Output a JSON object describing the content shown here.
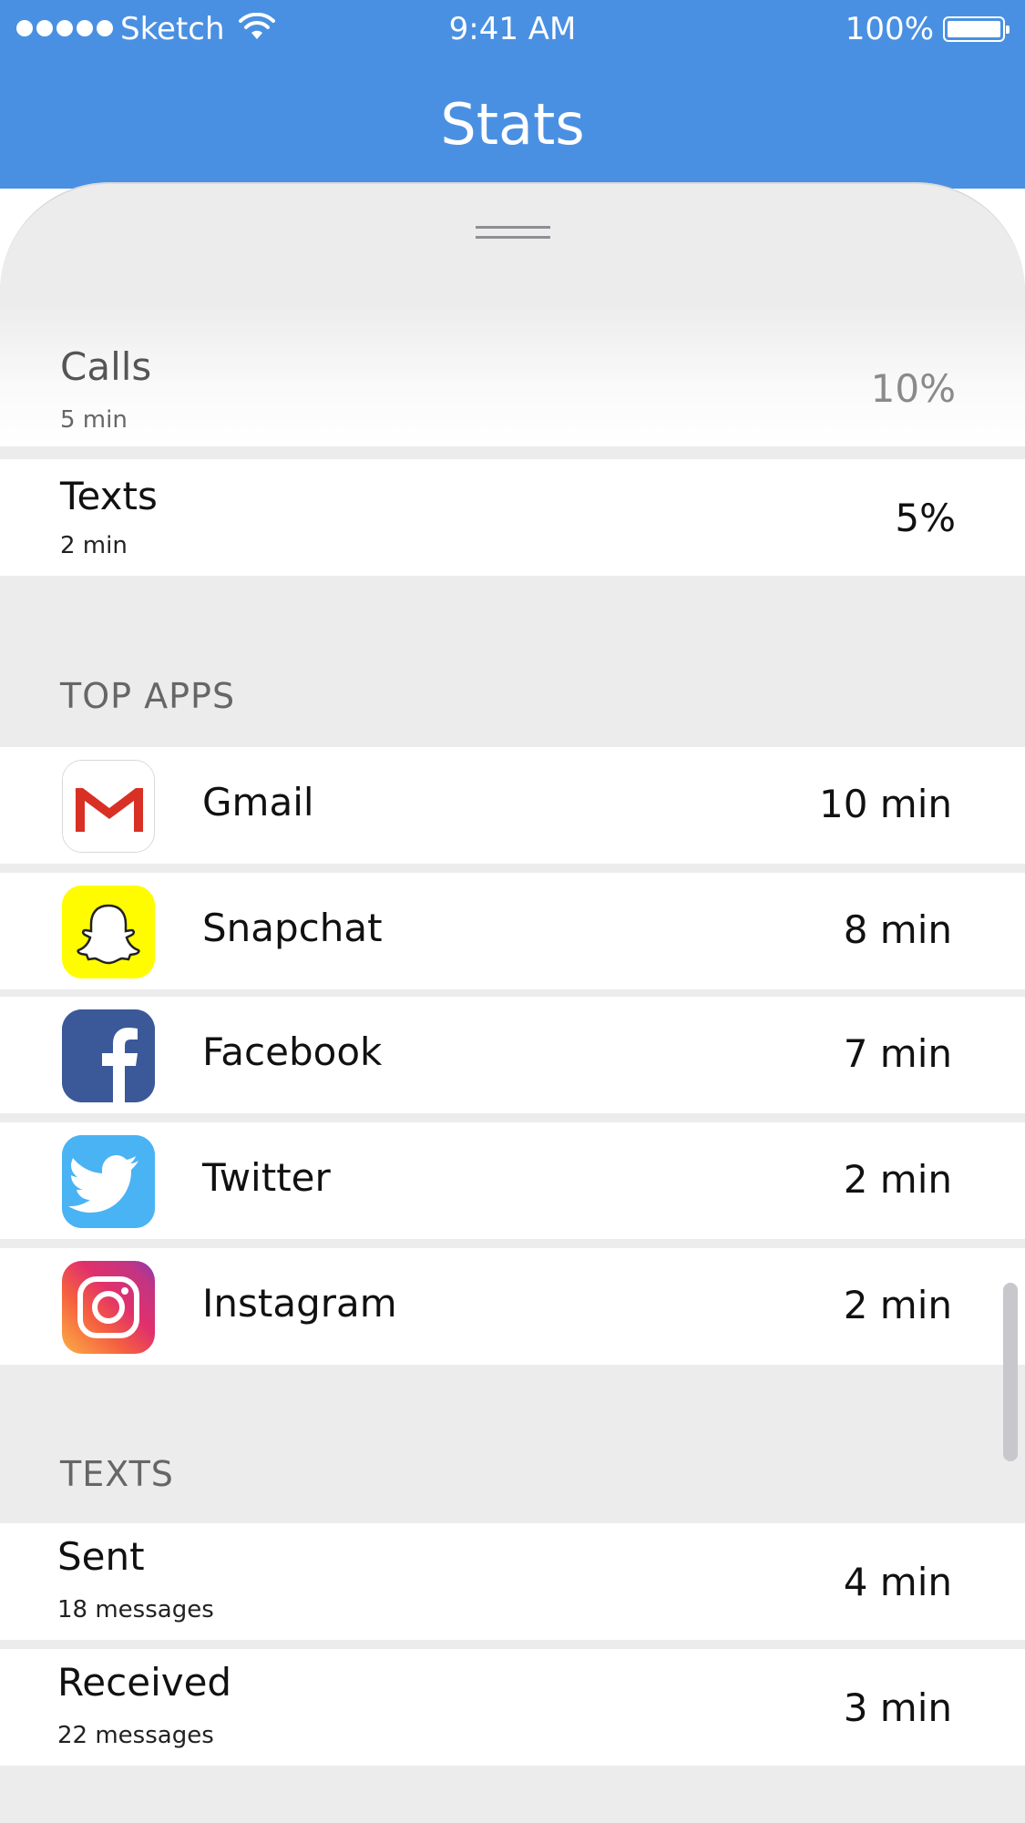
{
  "status_bar": {
    "carrier": "Sketch",
    "time": "9:41 AM",
    "battery": "100%"
  },
  "header": {
    "title": "Stats"
  },
  "usage": [
    {
      "label": "Calls",
      "detail": "5 min",
      "value": "10%"
    },
    {
      "label": "Texts",
      "detail": "2 min",
      "value": "5%"
    }
  ],
  "top_apps": {
    "header": "TOP APPS",
    "items": [
      {
        "name": "Gmail",
        "time": "10 min",
        "icon": "gmail-icon"
      },
      {
        "name": "Snapchat",
        "time": "8 min",
        "icon": "snapchat-icon"
      },
      {
        "name": "Facebook",
        "time": "7 min",
        "icon": "facebook-icon"
      },
      {
        "name": "Twitter",
        "time": "2 min",
        "icon": "twitter-icon"
      },
      {
        "name": "Instagram",
        "time": "2 min",
        "icon": "instagram-icon"
      }
    ]
  },
  "texts": {
    "header": "TEXTS",
    "items": [
      {
        "label": "Sent",
        "detail": "18 messages",
        "value": "4 min"
      },
      {
        "label": "Received",
        "detail": "22 messages",
        "value": "3 min"
      }
    ]
  },
  "colors": {
    "accent": "#4a90e2",
    "background": "#ececec"
  }
}
